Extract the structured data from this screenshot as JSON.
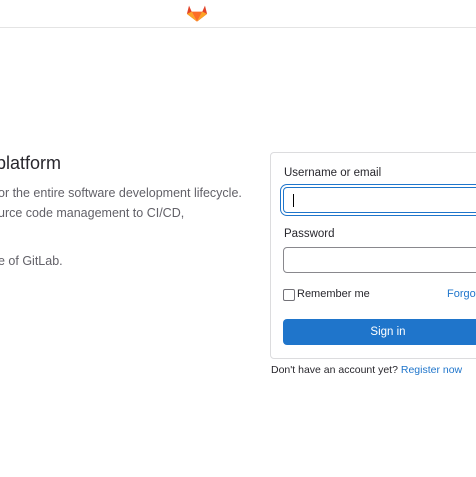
{
  "header": {
    "logo_icon": "gitlab-tanuki-logo-icon"
  },
  "intro": {
    "title": "platform",
    "description_lines": [
      "or the entire software development lifecycle.",
      "urce code management to CI/CD,"
    ],
    "footer_line": "e of GitLab."
  },
  "signin_form": {
    "username_label": "Username or email",
    "username_value": "",
    "password_label": "Password",
    "password_value": "",
    "remember_label": "Remember me",
    "forgot_label": "Forgot",
    "submit_label": "Sign in"
  },
  "register": {
    "prompt": "Don't have an account yet?",
    "link_label": "Register now"
  },
  "colors": {
    "primary": "#1f75cb",
    "logo_orange": "#fc6d26"
  }
}
